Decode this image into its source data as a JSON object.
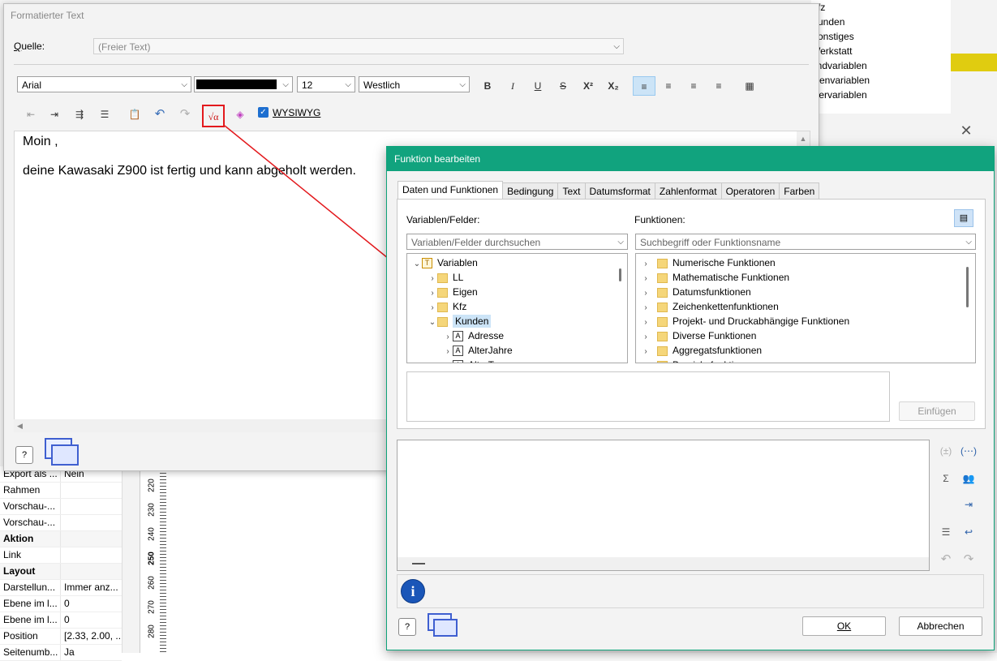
{
  "background": {
    "tree_items": [
      "Kfz",
      "Kunden",
      "Sonstiges",
      "Werkstatt",
      "andvariablen",
      "menvariablen",
      "tzervariablen"
    ],
    "properties": [
      {
        "key": "Export als ...",
        "value": "Nein",
        "head": false
      },
      {
        "key": "Rahmen",
        "value": "",
        "head": false
      },
      {
        "key": "Vorschau-...",
        "value": "",
        "head": false
      },
      {
        "key": "Vorschau-...",
        "value": "",
        "head": false
      },
      {
        "key": "Aktion",
        "value": "",
        "head": true
      },
      {
        "key": "Link",
        "value": "",
        "head": false
      },
      {
        "key": "Layout",
        "value": "",
        "head": true
      },
      {
        "key": "Darstellun...",
        "value": "Immer anz...",
        "head": false
      },
      {
        "key": "Ebene im l...",
        "value": "0",
        "head": false
      },
      {
        "key": "Ebene im l...",
        "value": "0",
        "head": false
      },
      {
        "key": "Position",
        "value": "[2.33, 2.00, ...",
        "head": false
      },
      {
        "key": "Seitenumb...",
        "value": "Ja",
        "head": false
      }
    ],
    "ruler_ticks": [
      "220",
      "230",
      "240",
      "250",
      "260",
      "270",
      "280"
    ],
    "close_glyph": "✕"
  },
  "formatted_text": {
    "title": "Formatierter Text",
    "source_label": "Quelle:",
    "source_value": "(Freier Text)",
    "font": "Arial",
    "size": "12",
    "script": "Westlich",
    "color": "#000000",
    "wysiwyg_label": "WYSIWYG",
    "editor_lines": [
      "Moin ,",
      "deine Kawasaki Z900 ist fertig und kann abgeholt werden."
    ]
  },
  "function_dialog": {
    "title": "Funktion bearbeiten",
    "tabs": [
      "Daten und Funktionen",
      "Bedingung",
      "Text",
      "Datumsformat",
      "Zahlenformat",
      "Operatoren",
      "Farben"
    ],
    "variables_label": "Variablen/Felder:",
    "variables_search_placeholder": "Variablen/Felder durchsuchen",
    "functions_label": "Funktionen:",
    "functions_search_placeholder": "Suchbegriff oder Funktionsname",
    "variables_tree": [
      {
        "label": "Variablen",
        "level": 0,
        "expanded": true,
        "kind": "var-root"
      },
      {
        "label": "LL",
        "level": 1,
        "expanded": false,
        "kind": "folder"
      },
      {
        "label": "Eigen",
        "level": 1,
        "expanded": false,
        "kind": "folder"
      },
      {
        "label": "Kfz",
        "level": 1,
        "expanded": false,
        "kind": "folder"
      },
      {
        "label": "Kunden",
        "level": 1,
        "expanded": true,
        "kind": "folder",
        "selected": true
      },
      {
        "label": "Adresse",
        "level": 2,
        "expanded": false,
        "kind": "field"
      },
      {
        "label": "AlterJahre",
        "level": 2,
        "expanded": false,
        "kind": "field"
      },
      {
        "label": "AlterTage",
        "level": 2,
        "expanded": false,
        "kind": "field"
      }
    ],
    "functions_tree": [
      "Numerische Funktionen",
      "Mathematische Funktionen",
      "Datumsfunktionen",
      "Zeichenkettenfunktionen",
      "Projekt- und Druckabhängige Funktionen",
      "Diverse Funktionen",
      "Aggregatsfunktionen",
      "Bereichsfunktionen"
    ],
    "insert_label": "Einfügen",
    "ok_label": "OK",
    "cancel_label": "Abbrechen",
    "info_glyph": "i"
  }
}
